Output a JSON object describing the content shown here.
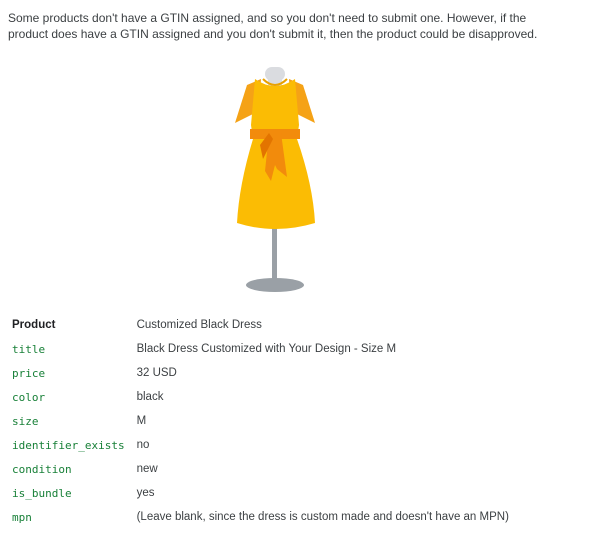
{
  "intro": {
    "line1": "Some products don't have a GTIN assigned, and so you don't need to submit one. However, if the",
    "line2": "product does have a GTIN assigned and you don't submit it, then the product could be disapproved."
  },
  "illustration": {
    "icon": "dress-on-mannequin-icon",
    "dress_color": "#f9b71d",
    "sash_color": "#f28b0c",
    "stand_color": "#9aa0a6"
  },
  "table": {
    "header": {
      "key": "Product",
      "value": "Customized Black Dress"
    },
    "rows": [
      {
        "key": "title",
        "value": "Black Dress Customized with Your Design - Size M"
      },
      {
        "key": "price",
        "value": "32 USD"
      },
      {
        "key": "color",
        "value": "black"
      },
      {
        "key": "size",
        "value": "M"
      },
      {
        "key": "identifier_exists",
        "value": "no"
      },
      {
        "key": "condition",
        "value": "new"
      },
      {
        "key": "is_bundle",
        "value": "yes"
      },
      {
        "key": "mpn",
        "value": "(Leave blank, since the dress is custom made and doesn't have an MPN)"
      }
    ]
  }
}
